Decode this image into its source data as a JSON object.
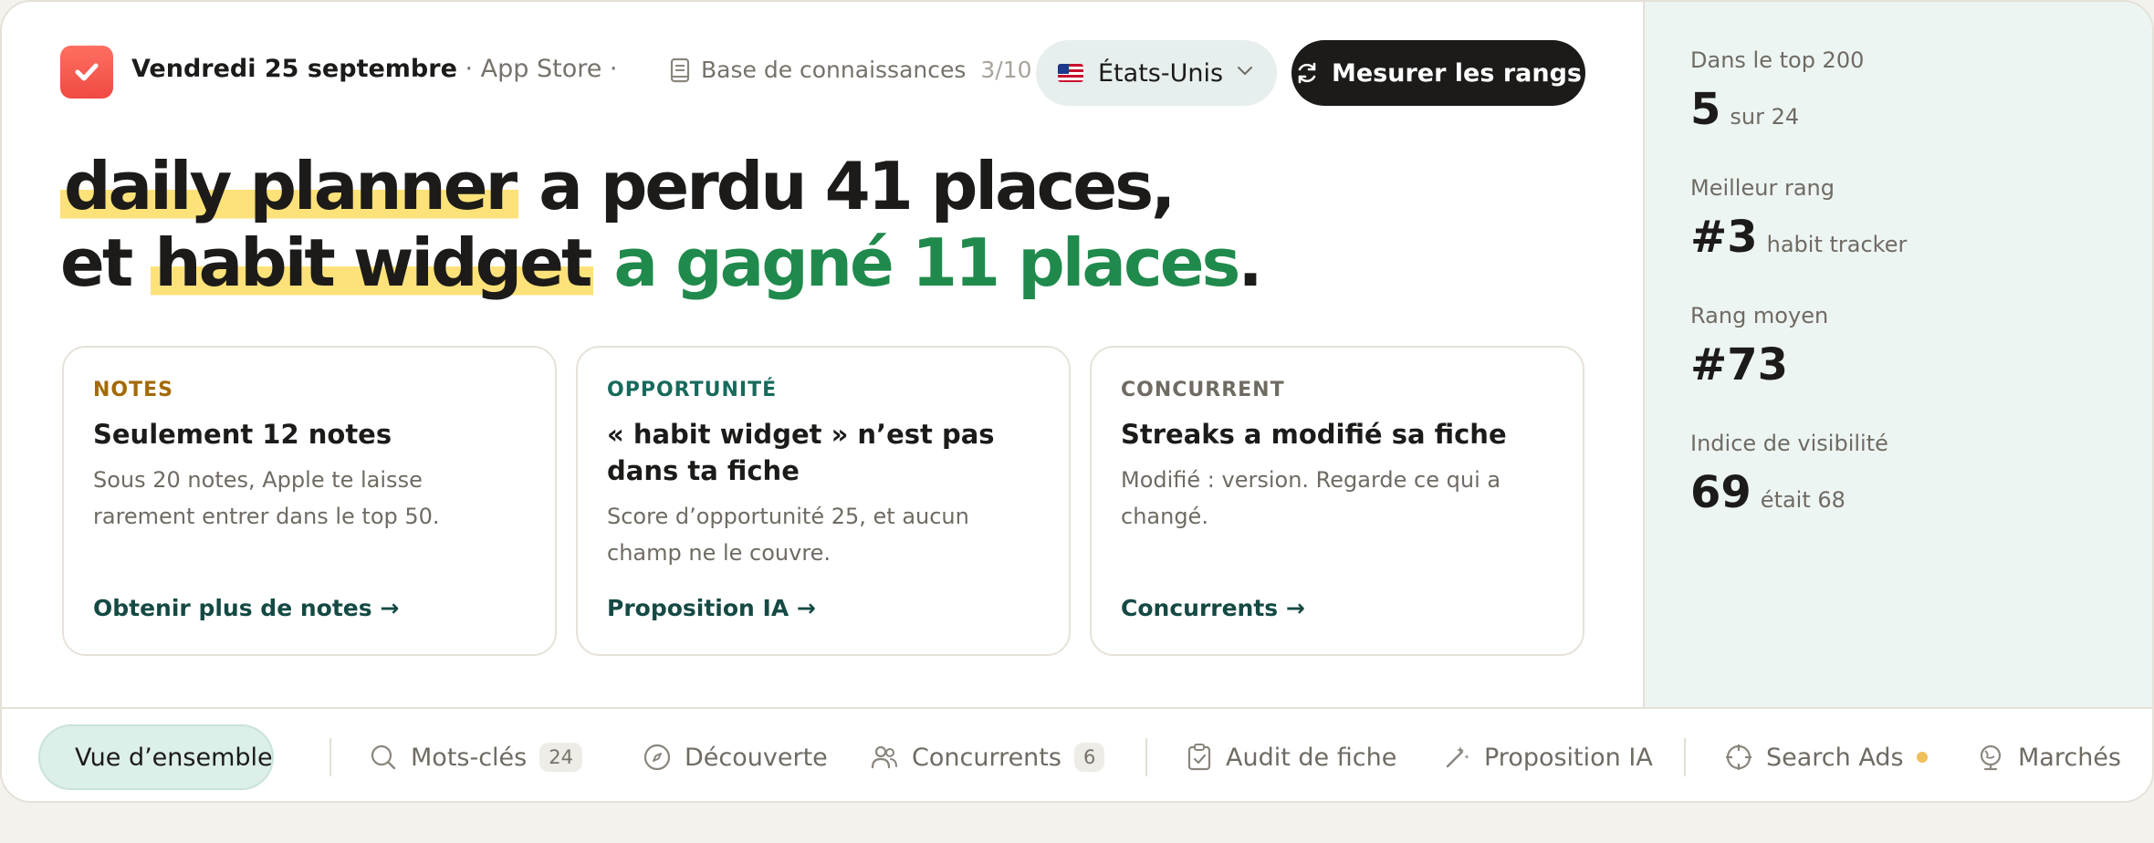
{
  "header": {
    "date": "Vendredi 25 septembre",
    "subtitle": " · App Store · mesu...",
    "knowledge_base": {
      "label": "Base de connaissances",
      "count": "3/10"
    },
    "country": "États-Unis",
    "measure_button": "Mesurer les rangs"
  },
  "headline": {
    "kw1": "daily planner",
    "part1": " a perdu 41 places,",
    "part2_start": "et ",
    "kw2": "habit widget",
    "gain": " a gagné 11 places",
    "end": "."
  },
  "cards": [
    {
      "kicker": "NOTES",
      "kicker_color": "#a36a06",
      "title": "Seulement 12 notes",
      "body": "Sous 20 notes, Apple te laisse rarement entrer dans le top 50.",
      "link": "Obtenir plus de notes →"
    },
    {
      "kicker": "OPPORTUNITÉ",
      "kicker_color": "#176a5c",
      "title": "« habit widget » n’est pas dans ta fiche",
      "body": "Score d’opportunité 25, et aucun champ ne le couvre.",
      "link": "Proposition IA →"
    },
    {
      "kicker": "CONCURRENT",
      "kicker_color": "#6f6b63",
      "title": "Streaks a modifié sa fiche",
      "body": "Modifié : version. Regarde ce qui a changé.",
      "link": "Concurrents →"
    }
  ],
  "stats": [
    {
      "label": "Dans le top 200",
      "value": "5",
      "suffix": "sur 24"
    },
    {
      "label": "Meilleur rang",
      "value": "#3",
      "suffix": "habit tracker"
    },
    {
      "label": "Rang moyen",
      "value": "#73",
      "suffix": ""
    },
    {
      "label": "Indice de visibilité",
      "value": "69",
      "suffix": "était 68"
    }
  ],
  "nav": {
    "overview": "Vue d’ensemble",
    "keywords": "Mots-clés",
    "keywords_count": "24",
    "discovery": "Découverte",
    "competitors": "Concurrents",
    "competitors_count": "6",
    "audit": "Audit de fiche",
    "ai_proposal": "Proposition IA",
    "search_ads": "Search Ads",
    "markets": "Marchés"
  },
  "colors": {
    "accent_green": "#1f8a4c",
    "highlight": "#fde27a",
    "dark": "#1c1b19",
    "sidebar_bg": "#edf5f3"
  }
}
